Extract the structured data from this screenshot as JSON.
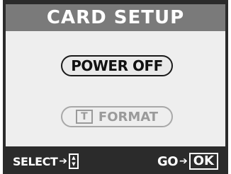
{
  "title": "CARD SETUP",
  "menu": {
    "power_off_label": "POWER OFF",
    "format_label": "FORMAT",
    "format_icon_glyph": "T"
  },
  "footer": {
    "select_label": "SELECT",
    "select_arrow": "➔",
    "updown_up": "▲",
    "updown_down": "▼",
    "go_label": "GO",
    "go_arrow": "➔",
    "ok_label": "OK"
  },
  "colors": {
    "title_bg": "#7a7a7a",
    "content_bg": "#eeeeee",
    "frame_bg": "#2b2b2b",
    "selected_border": "#1a1a1a",
    "disabled_text": "#9a9a9a"
  }
}
